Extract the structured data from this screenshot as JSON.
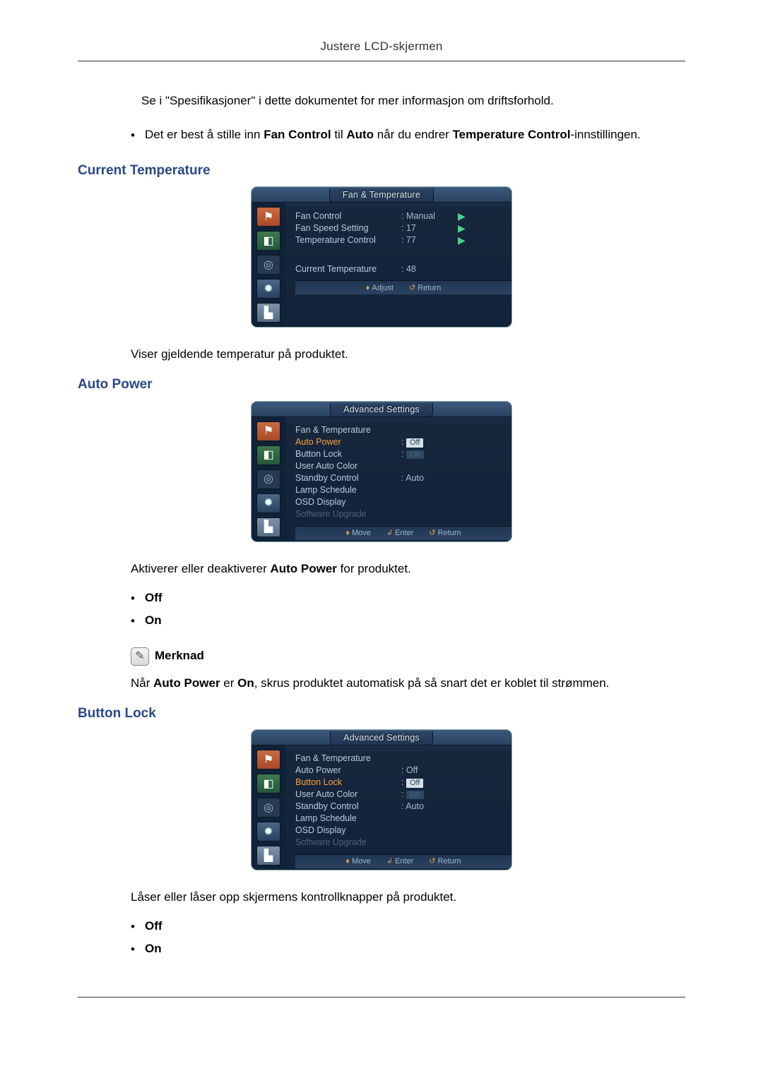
{
  "header": {
    "title": "Justere LCD-skjermen"
  },
  "intro": {
    "p1": "Se i \"Spesifikasjoner\" i dette dokumentet for mer informasjon om driftsforhold.",
    "bullet_pre": "Det er best å stille inn ",
    "bullet_b1": "Fan Control",
    "bullet_mid1": " til ",
    "bullet_b2": "Auto",
    "bullet_mid2": " når du endrer ",
    "bullet_b3": "Temperature Control",
    "bullet_post": "-innstillingen."
  },
  "sec1": {
    "title": "Current Temperature",
    "desc": "Viser gjeldende temperatur på produktet.",
    "osd": {
      "title": "Fan & Temperature",
      "rows": [
        {
          "label": "Fan Control",
          "val": "Manual"
        },
        {
          "label": "Fan Speed Setting",
          "val": "17"
        },
        {
          "label": "Temperature Control",
          "val": "77"
        }
      ],
      "current": {
        "label": "Current Temperature",
        "val": "48"
      },
      "foot": {
        "a": "Adjust",
        "b": "Return"
      }
    }
  },
  "sec2": {
    "title": "Auto Power",
    "desc_pre": "Aktiverer eller deaktiverer ",
    "desc_b": "Auto Power",
    "desc_post": " for produktet.",
    "opts": [
      "Off",
      "On"
    ],
    "osd": {
      "title": "Advanced Settings",
      "rows": [
        {
          "label": "Fan & Temperature",
          "val": ""
        },
        {
          "label": "Auto Power",
          "val": "Off",
          "hl": true,
          "sel": true
        },
        {
          "label": "Button Lock",
          "val": "On",
          "dimval": true
        },
        {
          "label": "User Auto Color",
          "val": ""
        },
        {
          "label": "Standby Control",
          "val": "Auto"
        },
        {
          "label": "Lamp Schedule",
          "val": ""
        },
        {
          "label": "OSD Display",
          "val": ""
        },
        {
          "label": "Software Upgrade",
          "val": "",
          "dim": true
        }
      ],
      "foot": {
        "a": "Move",
        "b": "Enter",
        "c": "Return"
      }
    },
    "merknad_label": "Merknad",
    "note_pre": "Når ",
    "note_b1": "Auto Power",
    "note_mid1": " er ",
    "note_b2": "On",
    "note_post": ", skrus produktet automatisk på så snart det er koblet til strømmen."
  },
  "sec3": {
    "title": "Button Lock",
    "desc": "Låser eller låser opp skjermens kontrollknapper på produktet.",
    "opts": [
      "Off",
      "On"
    ],
    "osd": {
      "title": "Advanced Settings",
      "rows": [
        {
          "label": "Fan & Temperature",
          "val": ""
        },
        {
          "label": "Auto Power",
          "val": "Off"
        },
        {
          "label": "Button Lock",
          "val": "Off",
          "hl": true,
          "sel": true
        },
        {
          "label": "User Auto Color",
          "val": "On",
          "dimval": true
        },
        {
          "label": "Standby Control",
          "val": "Auto"
        },
        {
          "label": "Lamp Schedule",
          "val": ""
        },
        {
          "label": "OSD Display",
          "val": ""
        },
        {
          "label": "Software Upgrade",
          "val": "",
          "dim": true
        }
      ],
      "foot": {
        "a": "Move",
        "b": "Enter",
        "c": "Return"
      }
    }
  }
}
